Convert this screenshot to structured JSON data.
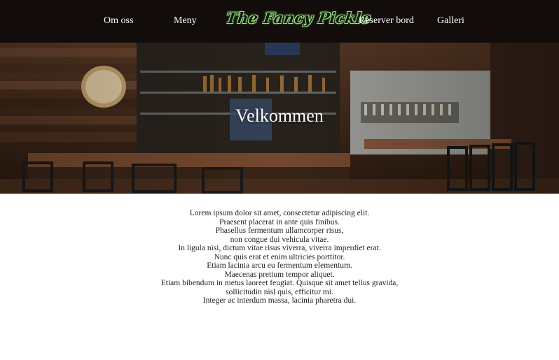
{
  "nav": {
    "links": [
      "Om oss",
      "Meny",
      "Reserver bord",
      "Galleri"
    ],
    "logo_text": "The Fancy Pickle"
  },
  "hero": {
    "title": "Velkommen"
  },
  "content": {
    "lines": [
      "Lorem ipsum dolor sit amet, consectetur adipiscing elit.",
      "Praesent placerat in ante quis finibus.",
      "Phasellus fermentum ullamcorper risus,",
      "non congue dui vehicula vitae.",
      "In ligula nisi, dictum vitae risus viverra, viverra imperdiet erat.",
      "Nunc quis erat et enim ultricies porttitor.",
      "Etiam lacinia arcu eu fermentum elementum.",
      "Maecenas pretium tempor aliquet.",
      "Etiam bibendum in metus laoreet feugiat. Quisque sit amet tellus gravida,",
      "sollicitudin nisl quis, efficitur mi.",
      "Integer ac interdum massa, lacinia pharetra dui."
    ]
  },
  "colors": {
    "nav_background": "#120c0a",
    "logo_outline": "#9ee08a",
    "page_background": "#ffffff"
  }
}
